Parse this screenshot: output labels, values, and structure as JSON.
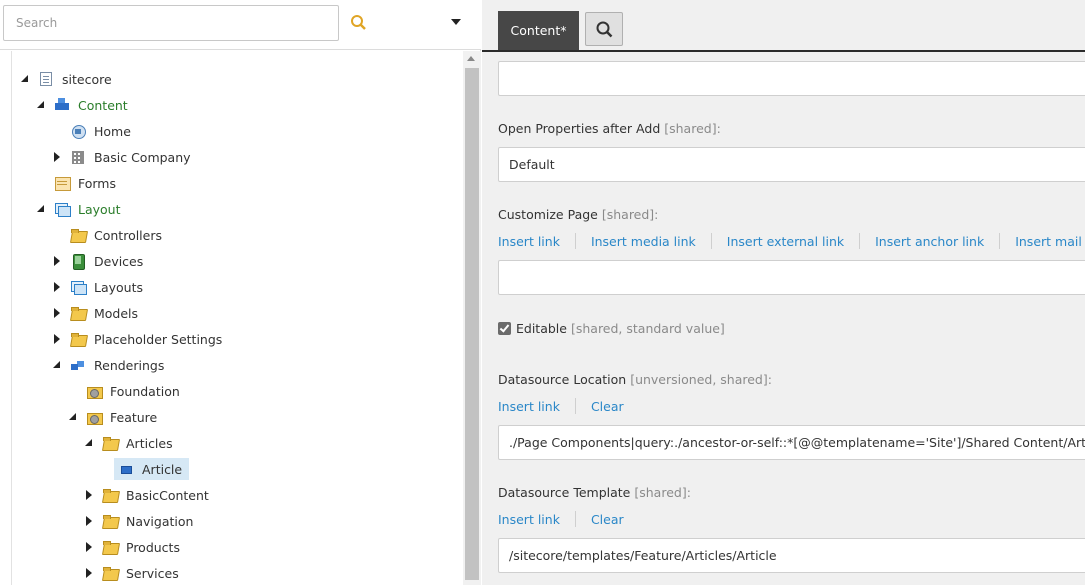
{
  "search": {
    "placeholder": "Search"
  },
  "tree": {
    "nodes": [
      {
        "label": "sitecore",
        "icon": "page-icon",
        "toggle": "expanded"
      },
      {
        "label": "Content",
        "icon": "content-cubes-icon",
        "toggle": "expanded"
      },
      {
        "label": "Home",
        "icon": "home-icon",
        "toggle": "none"
      },
      {
        "label": "Basic Company",
        "icon": "building-icon",
        "toggle": "collapsed"
      },
      {
        "label": "Forms",
        "icon": "forms-icon",
        "toggle": "none"
      },
      {
        "label": "Layout",
        "icon": "layout-icon",
        "toggle": "expanded"
      },
      {
        "label": "Controllers",
        "icon": "folder-icon",
        "toggle": "none"
      },
      {
        "label": "Devices",
        "icon": "device-icon",
        "toggle": "collapsed"
      },
      {
        "label": "Layouts",
        "icon": "layouts-icon",
        "toggle": "collapsed"
      },
      {
        "label": "Models",
        "icon": "folder-icon",
        "toggle": "collapsed"
      },
      {
        "label": "Placeholder Settings",
        "icon": "folder-icon",
        "toggle": "collapsed"
      },
      {
        "label": "Renderings",
        "icon": "renderings-icon",
        "toggle": "expanded"
      },
      {
        "label": "Foundation",
        "icon": "gear-folder-icon",
        "toggle": "none"
      },
      {
        "label": "Feature",
        "icon": "feature-folder-icon",
        "toggle": "expanded"
      },
      {
        "label": "Articles",
        "icon": "folder-icon",
        "toggle": "expanded"
      },
      {
        "label": "Article",
        "icon": "rendering-item-icon",
        "toggle": "none",
        "selected": true
      },
      {
        "label": "BasicContent",
        "icon": "folder-icon",
        "toggle": "collapsed"
      },
      {
        "label": "Navigation",
        "icon": "folder-icon",
        "toggle": "collapsed"
      },
      {
        "label": "Products",
        "icon": "folder-icon",
        "toggle": "collapsed"
      },
      {
        "label": "Services",
        "icon": "folder-icon",
        "toggle": "collapsed"
      }
    ]
  },
  "editor": {
    "tabs": {
      "content_label": "Content*",
      "search_icon": "search-icon"
    },
    "fields": {
      "open_properties": {
        "label": "Open Properties after Add",
        "meta": "[shared]:",
        "value": "Default"
      },
      "customize_page": {
        "label": "Customize Page",
        "meta": "[shared]:",
        "links": [
          "Insert link",
          "Insert media link",
          "Insert external link",
          "Insert anchor link",
          "Insert mail address link"
        ],
        "value": ""
      },
      "editable": {
        "label": "Editable",
        "meta": "[shared, standard value]",
        "checked": true
      },
      "datasource_location": {
        "label": "Datasource Location",
        "meta": "[unversioned, shared]:",
        "links": [
          "Insert link",
          "Clear"
        ],
        "value": "./Page Components|query:./ancestor-or-self::*[@@templatename='Site']/Shared Content/Articles"
      },
      "datasource_template": {
        "label": "Datasource Template",
        "meta": "[shared]:",
        "links": [
          "Insert link",
          "Clear"
        ],
        "value": "/sitecore/templates/Feature/Articles/Article"
      }
    }
  },
  "colors": {
    "link": "#2a87c8",
    "active_tab": "#474747",
    "green_node": "#2a7d2a",
    "selection": "#d6e8f5"
  }
}
